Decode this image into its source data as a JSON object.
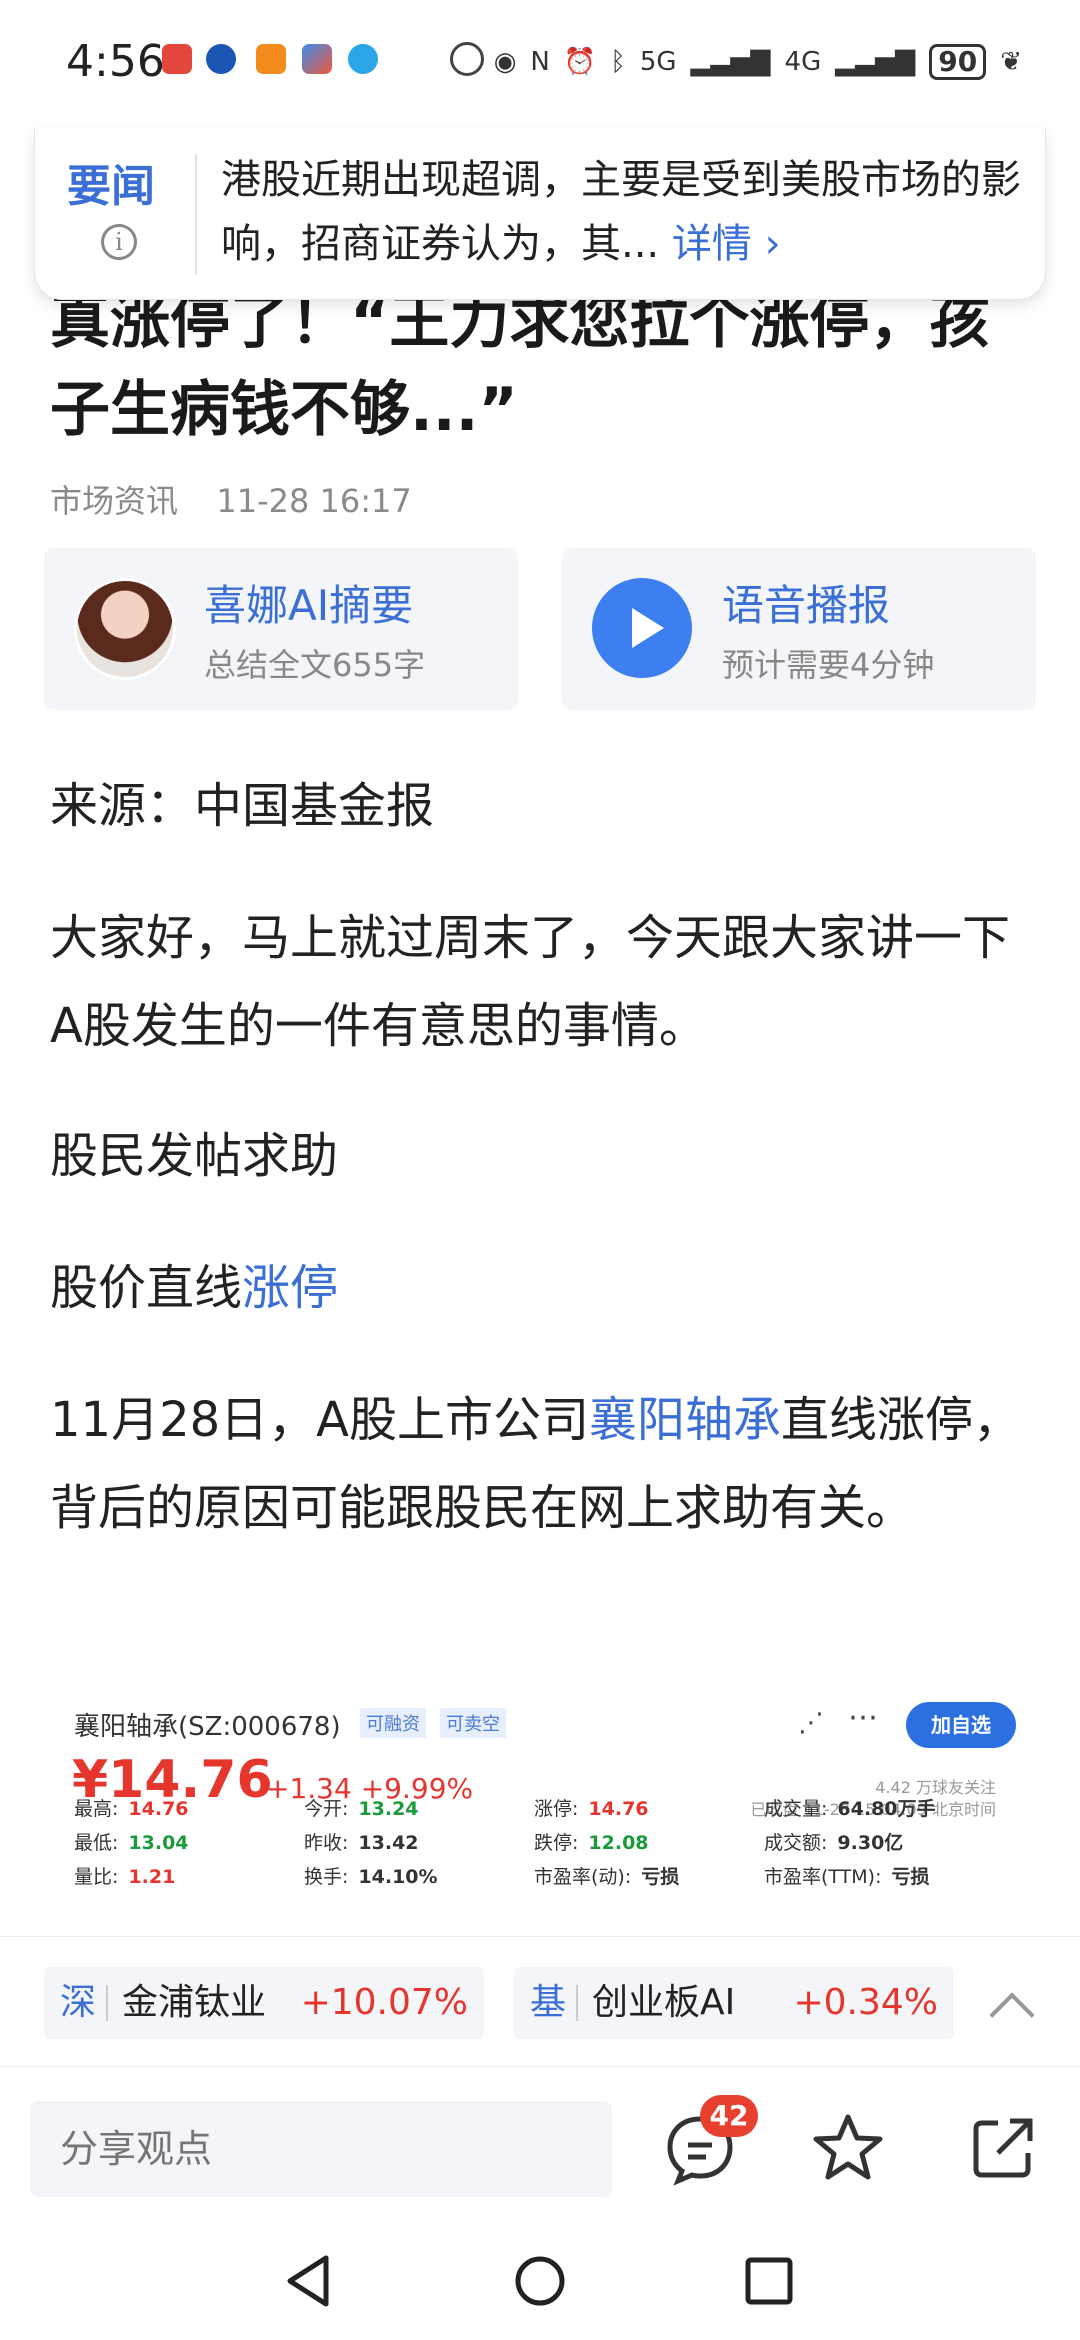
{
  "status_bar": {
    "time": "4:56",
    "signal_5g": "5G",
    "signal_4g": "4G",
    "battery": "90"
  },
  "toast": {
    "badge": "要闻",
    "text": "港股近期出现超调，主要是受到美股市场的影响，招商证券认为，其...",
    "more": "详情 ›"
  },
  "article": {
    "title": "真涨停了！“王力求您拉个涨停，孩子生病钱不够...”",
    "source_name": "市场资讯",
    "time": "11-28 16:17",
    "ai_card": {
      "title": "喜娜AI摘要",
      "subtitle": "总结全文655字"
    },
    "voice_card": {
      "title": "语音播报",
      "subtitle": "预计需要4分钟"
    },
    "paragraphs": {
      "source": "来源：中国基金报",
      "intro": "大家好，马上就过周末了，今天跟大家讲一下A股发生的一件有意思的事情。",
      "heading1": "股民发帖求助",
      "heading2_prefix": "股价直线",
      "heading2_link": "涨停",
      "p3_prefix": "11月28日，A股上市公司",
      "p3_link": "襄阳轴承",
      "p3_suffix": "直线涨停，背后的原因可能跟股民在网上求助有关。"
    }
  },
  "stock_card": {
    "name": "襄阳轴承(SZ:000678)",
    "tag1": "可融资",
    "tag2": "可卖空",
    "price": "¥14.76",
    "change": "+1.34 +9.99%",
    "add_label": "加自选",
    "fans": "4.42 万球友关注",
    "closed": "已收盘 11-28 15:04:09 北京时间",
    "rows": [
      [
        [
          "最高:",
          "14.76",
          "red"
        ],
        [
          "今开:",
          "13.24",
          "green"
        ],
        [
          "涨停:",
          "14.76",
          "red"
        ],
        [
          "成交量:",
          "64.80万手",
          ""
        ]
      ],
      [
        [
          "最低:",
          "13.04",
          "green"
        ],
        [
          "昨收:",
          "13.42",
          ""
        ],
        [
          "跌停:",
          "12.08",
          "green"
        ],
        [
          "成交额:",
          "9.30亿",
          ""
        ]
      ],
      [
        [
          "量比:",
          "1.21",
          "red"
        ],
        [
          "换手:",
          "14.10%",
          ""
        ],
        [
          "市盈率(动):",
          "亏损",
          ""
        ],
        [
          "市盈率(TTM):",
          "亏损",
          ""
        ]
      ]
    ]
  },
  "tickers": [
    {
      "market": "深",
      "name": "金浦钛业",
      "change": "+10.07%"
    },
    {
      "market": "基",
      "name": "创业板AI",
      "change": "+0.34%"
    }
  ],
  "comment_bar": {
    "placeholder": "分享观点",
    "comment_count": "42"
  },
  "colors": {
    "accent_blue": "#3b6fd6",
    "up_red": "#e5352d",
    "down_green": "#1a9a3a"
  },
  "icons": [
    "info-icon",
    "play-icon",
    "share-icon",
    "more-icon",
    "chevron-up-icon",
    "comment-icon",
    "star-icon",
    "forward-icon",
    "back-nav-icon",
    "home-nav-icon",
    "recents-nav-icon"
  ]
}
